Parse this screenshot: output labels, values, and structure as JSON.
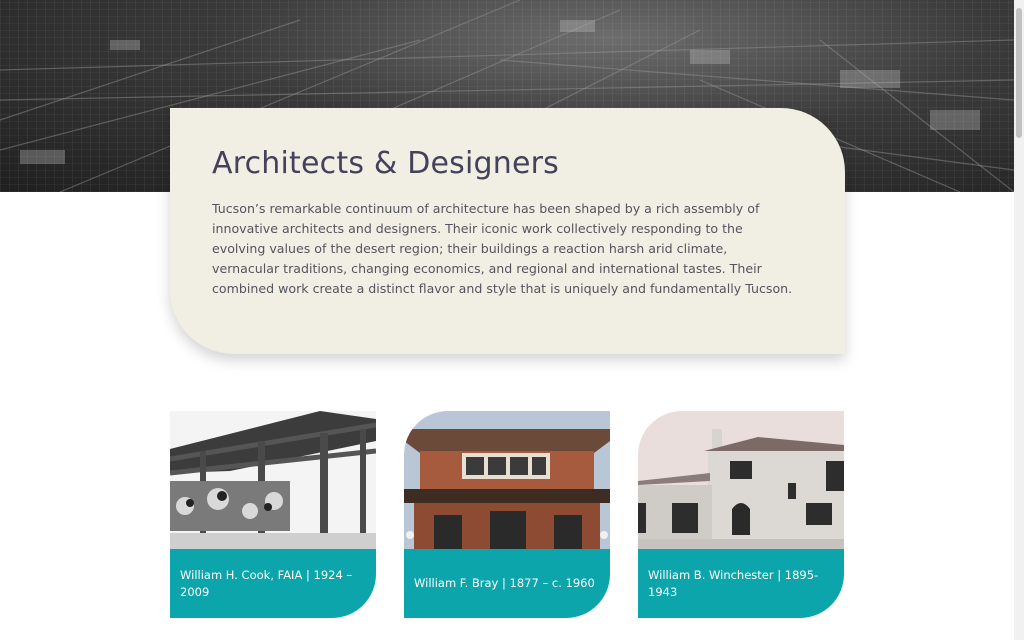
{
  "intro": {
    "title": "Architects & Designers",
    "text": "Tucson’s remarkable continuum of architecture has been shaped by a rich assembly of innovative architects and designers. Their iconic work collectively responding to the evolving values of the desert region; their buildings a reaction harsh arid climate, vernacular traditions, changing economics, and regional and international tastes. Their combined work create a distinct flavor and style that is uniquely and fundamentally Tucson."
  },
  "architects": [
    {
      "caption": "William H. Cook, FAIA | 1924 – 2009"
    },
    {
      "caption": "William F. Bray | 1877 – c. 1960"
    },
    {
      "caption": "William B. Winchester | 1895-1943"
    }
  ],
  "colors": {
    "accent": "#0ca5ac",
    "card_background": "#f1efe4",
    "title": "#43425a"
  }
}
